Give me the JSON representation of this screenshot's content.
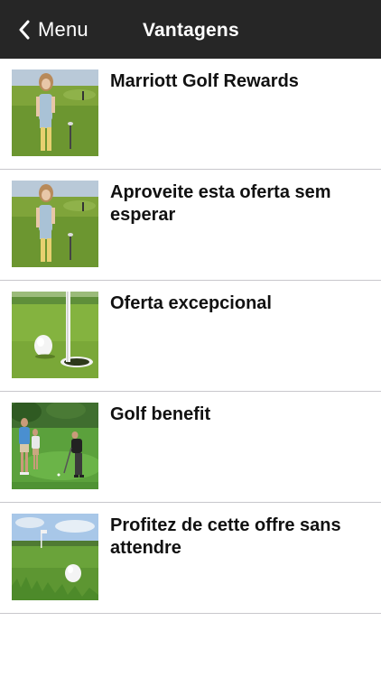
{
  "navbar": {
    "back_label": "Menu",
    "title": "Vantagens"
  },
  "items": [
    {
      "title": "Marriott Golf Rewards",
      "thumbnail": "woman-golfer-image"
    },
    {
      "title": "Aproveite esta oferta sem esperar",
      "thumbnail": "woman-golfer-image"
    },
    {
      "title": "Oferta excepcional",
      "thumbnail": "golf-ball-hole-flag-image"
    },
    {
      "title": "Golf benefit",
      "thumbnail": "golfers-putting-image"
    },
    {
      "title": "Profitez de cette offre sans attendre",
      "thumbnail": "golf-ball-flag-sky-image"
    }
  ],
  "colors": {
    "navbar_bg": "#262626",
    "navbar_text": "#ffffff",
    "separator": "#c8c7cc",
    "title_text": "#111111"
  }
}
